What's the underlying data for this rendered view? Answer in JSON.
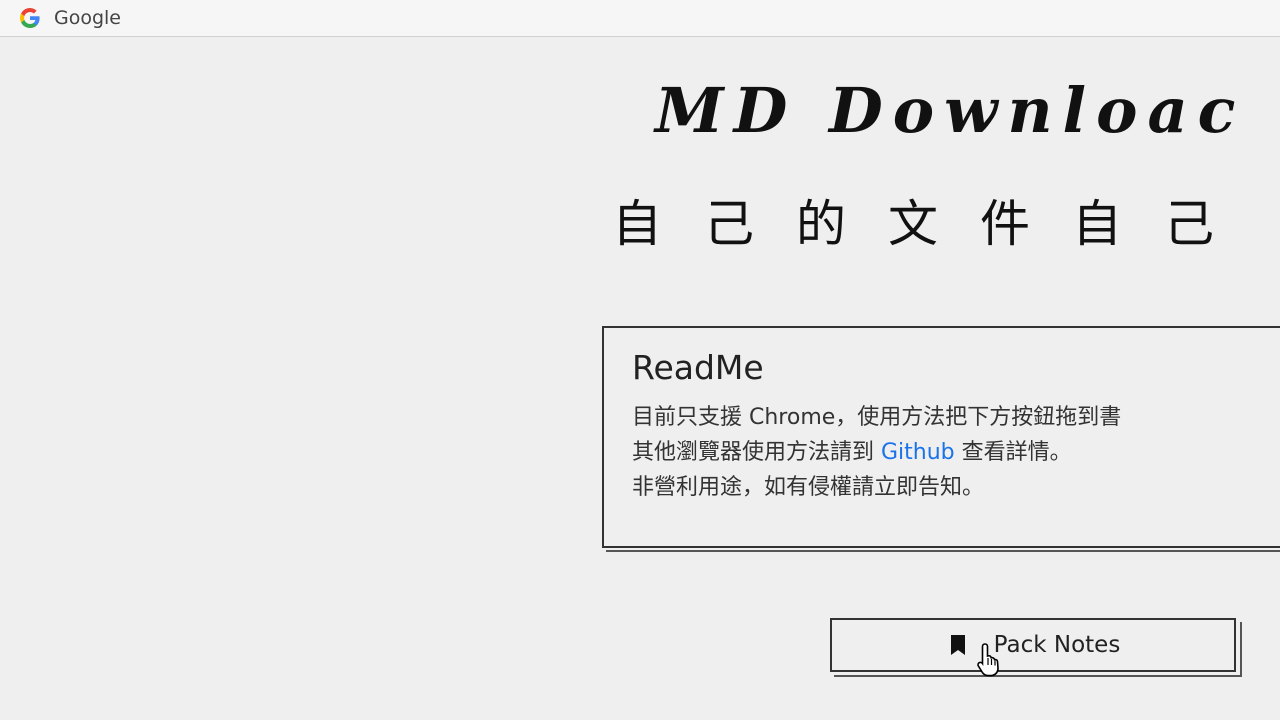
{
  "bookmarks_bar": {
    "items": [
      {
        "label": "Google",
        "icon": "google-g-icon"
      }
    ]
  },
  "header": {
    "title": "MD Downloac",
    "subtitle": "自己的文件自己"
  },
  "readme": {
    "title": "ReadMe",
    "line1": "目前只支援 Chrome，使用方法把下方按鈕拖到書",
    "line2_before": "其他瀏覽器使用方法請到 ",
    "line2_link": "Github",
    "line2_after": " 查看詳情。",
    "line3": "非營利用途，如有侵權請立即告知。"
  },
  "pack_button": {
    "label": "Pack Notes",
    "icon": "bookmark-icon"
  },
  "colors": {
    "background": "#efefef",
    "link": "#1a73e8",
    "text": "#222222"
  }
}
